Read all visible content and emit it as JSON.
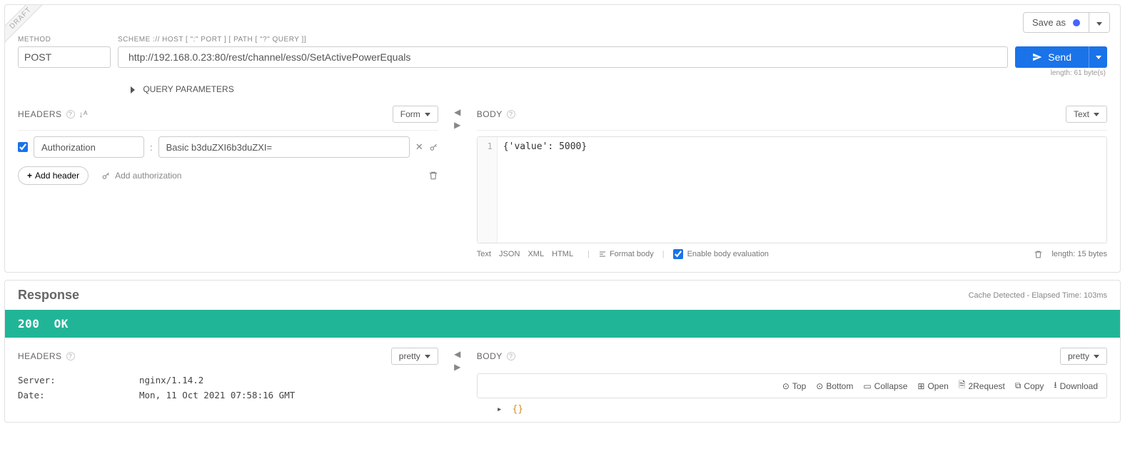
{
  "draft_label": "DRAFT",
  "save_as": {
    "label": "Save as"
  },
  "method": {
    "label": "METHOD",
    "value": "POST"
  },
  "url": {
    "label": "SCHEME :// HOST [ \":\" PORT ] [ PATH [ \"?\" QUERY ]]",
    "value": "http://192.168.0.23:80/rest/channel/ess0/SetActivePowerEquals"
  },
  "send_label": "Send",
  "length_line": "length: 61 byte(s)",
  "query_params_label": "QUERY PARAMETERS",
  "headers": {
    "title": "HEADERS",
    "mode": "Form",
    "row": {
      "enabled": true,
      "name": "Authorization",
      "value": "Basic b3duZXI6b3duZXI="
    },
    "add_header": "Add header",
    "add_auth": "Add authorization"
  },
  "body": {
    "title": "BODY",
    "mode": "Text",
    "line_no": "1",
    "content": "{'value': 5000}",
    "modes": {
      "text": "Text",
      "json": "JSON",
      "xml": "XML",
      "html": "HTML"
    },
    "format_label": "Format body",
    "eval_label": "Enable body evaluation",
    "eval_checked": true,
    "length": "length: 15 bytes"
  },
  "response": {
    "title": "Response",
    "meta": "Cache Detected - Elapsed Time: 103ms",
    "status_code": "200",
    "status_text": "OK",
    "headers_title": "HEADERS",
    "headers_mode": "pretty",
    "body_title": "BODY",
    "body_mode": "pretty",
    "headers_kv": [
      {
        "k": "Server:",
        "v": "nginx/1.14.2"
      },
      {
        "k": "Date:",
        "v": "Mon, 11 Oct 2021 07:58:16 GMT"
      }
    ],
    "toolbar": {
      "top": "Top",
      "bottom": "Bottom",
      "collapse": "Collapse",
      "open": "Open",
      "to_request": "2Request",
      "copy": "Copy",
      "download": "Download"
    }
  }
}
